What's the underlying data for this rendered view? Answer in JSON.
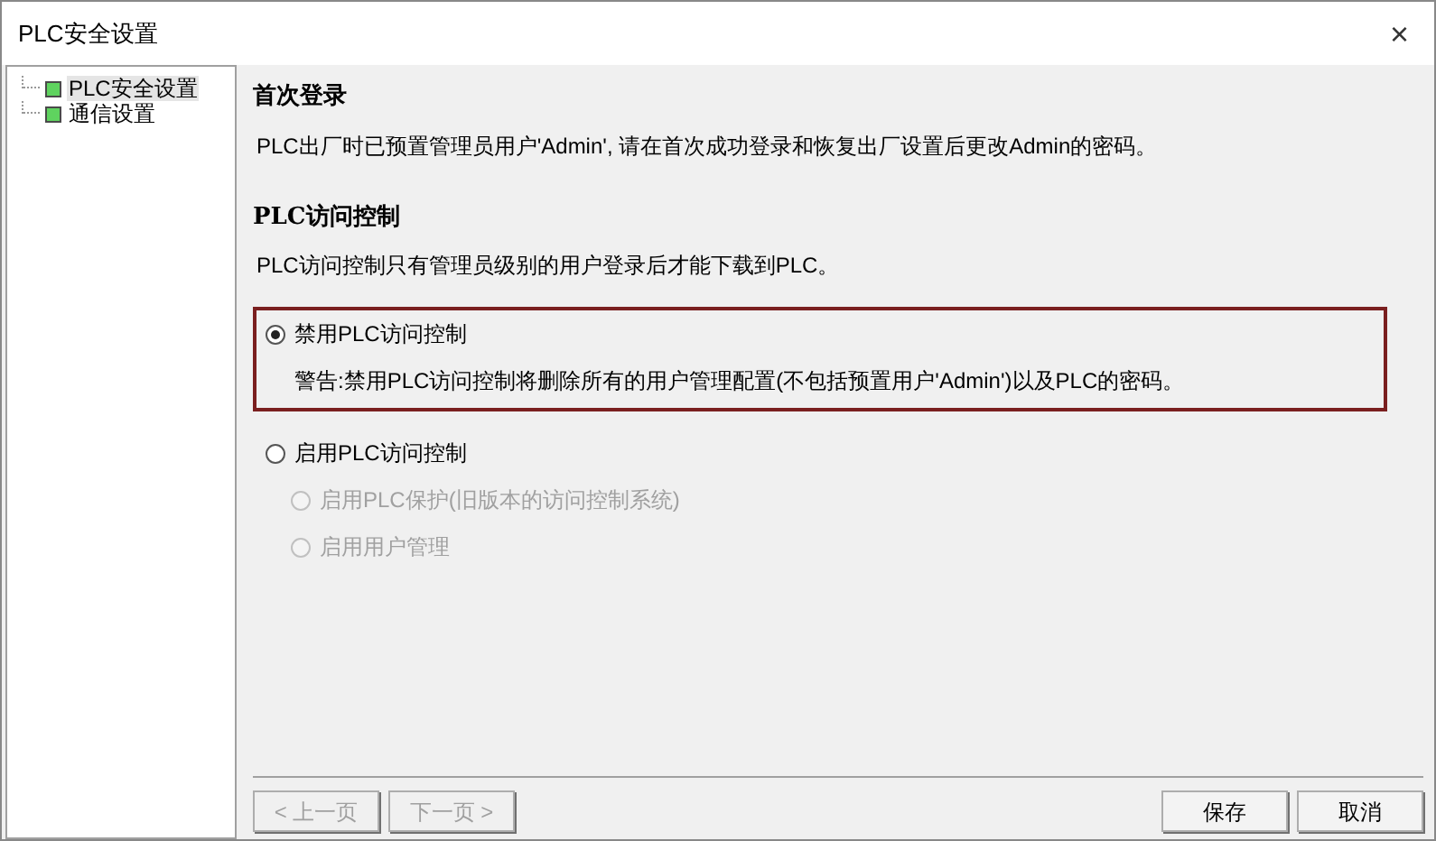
{
  "window": {
    "title": "PLC安全设置",
    "close": "×"
  },
  "tree": {
    "items": [
      {
        "label": "PLC安全设置",
        "selected": true
      },
      {
        "label": "通信设置",
        "selected": false
      }
    ]
  },
  "sections": [
    {
      "heading": "首次登录",
      "text": "PLC出厂时已预置管理员用户'Admin', 请在首次成功登录和恢复出厂设置后更改Admin的密码。"
    },
    {
      "heading": "PLC访问控制",
      "text": "PLC访问控制只有管理员级别的用户登录后才能下载到PLC。"
    }
  ],
  "options": [
    {
      "label": "禁用PLC访问控制",
      "selected": true,
      "disabled": false,
      "warning": "警告:禁用PLC访问控制将删除所有的用户管理配置(不包括预置用户'Admin')以及PLC的密码。"
    },
    {
      "label": "启用PLC访问控制",
      "selected": false,
      "disabled": false,
      "children": [
        {
          "label": "启用PLC保护(旧版本的访问控制系统)",
          "selected": false,
          "disabled": true
        },
        {
          "label": "启用用户管理",
          "selected": false,
          "disabled": true
        }
      ]
    }
  ],
  "nav_buttons": [
    {
      "label": "< 上一页",
      "disabled": true
    },
    {
      "label": "下一页 >",
      "disabled": true
    }
  ],
  "action_buttons": [
    {
      "label": "保存",
      "disabled": false
    },
    {
      "label": "取消",
      "disabled": false
    }
  ]
}
